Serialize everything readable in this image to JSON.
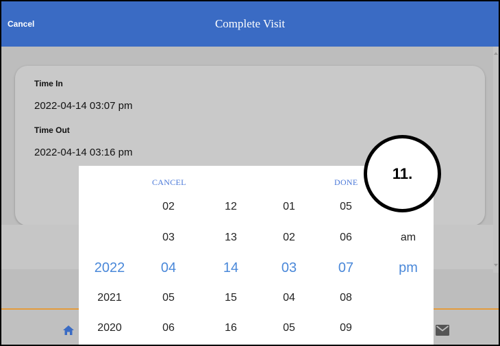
{
  "header": {
    "cancel_label": "Cancel",
    "title": "Complete Visit",
    "background": "#3a6bc4"
  },
  "visit": {
    "time_in_label": "Time In",
    "time_in_value": "2022-04-14 03:07 pm",
    "time_out_label": "Time Out",
    "time_out_value": "2022-04-14 03:16 pm"
  },
  "picker": {
    "cancel_label": "CANCEL",
    "done_label": "DONE",
    "accent": "#4a88d9",
    "columns": [
      {
        "name": "year",
        "items": [
          "",
          "",
          "2022",
          "2021",
          "2020"
        ],
        "selected": "2022"
      },
      {
        "name": "month",
        "items": [
          "02",
          "03",
          "04",
          "05",
          "06"
        ],
        "selected": "04"
      },
      {
        "name": "day",
        "items": [
          "12",
          "13",
          "14",
          "15",
          "16"
        ],
        "selected": "14"
      },
      {
        "name": "hour",
        "items": [
          "01",
          "02",
          "03",
          "04",
          "05"
        ],
        "selected": "03"
      },
      {
        "name": "minute",
        "items": [
          "05",
          "06",
          "07",
          "08",
          "09"
        ],
        "selected": "07"
      },
      {
        "name": "period",
        "items": [
          "",
          "am",
          "pm",
          "",
          ""
        ],
        "selected": "pm"
      }
    ]
  },
  "annotation": {
    "step_label": "11."
  },
  "bottom_nav": {
    "icons": [
      "home-icon",
      "mail-icon"
    ],
    "accent": "#e39b3c"
  }
}
